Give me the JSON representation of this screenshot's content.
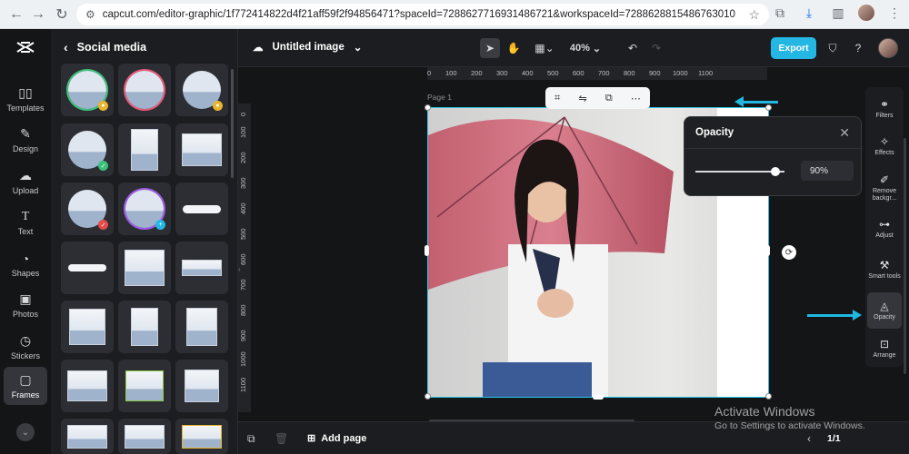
{
  "browser": {
    "url": "capcut.com/editor-graphic/1f772414822d4f21aff59f2f94856471?spaceId=7288627716931486721&workspaceId=7288628815486763010"
  },
  "rail": {
    "items": [
      {
        "label": "Templates",
        "icon": "templates-icon"
      },
      {
        "label": "Design",
        "icon": "design-icon"
      },
      {
        "label": "Upload",
        "icon": "upload-icon"
      },
      {
        "label": "Text",
        "icon": "text-icon"
      },
      {
        "label": "Shapes",
        "icon": "shapes-icon"
      },
      {
        "label": "Photos",
        "icon": "photos-icon"
      },
      {
        "label": "Stickers",
        "icon": "stickers-icon"
      },
      {
        "label": "Frames",
        "icon": "frames-icon"
      }
    ],
    "active": "Frames"
  },
  "panel": {
    "title": "Social media"
  },
  "topbar": {
    "doc_title": "Untitled image",
    "zoom": "40%",
    "export_label": "Export"
  },
  "canvas": {
    "page_label": "Page 1",
    "ruler_h": [
      "0",
      "100",
      "200",
      "300",
      "400",
      "500",
      "600",
      "700",
      "800",
      "900",
      "1000",
      "1100"
    ],
    "ruler_v": [
      "0",
      "100",
      "200",
      "300",
      "400",
      "500",
      "600",
      "700",
      "800",
      "900",
      "1000",
      "1100"
    ]
  },
  "opacity": {
    "title": "Opacity",
    "value": "90%",
    "level": 0.9
  },
  "props": [
    {
      "label": "Filters",
      "icon": "filters-icon"
    },
    {
      "label": "Effects",
      "icon": "effects-icon"
    },
    {
      "label": "Remove backgr...",
      "icon": "remove-background-icon"
    },
    {
      "label": "Adjust",
      "icon": "adjust-icon"
    },
    {
      "label": "Smart tools",
      "icon": "smart-tools-icon"
    },
    {
      "label": "Opacity",
      "icon": "opacity-icon"
    },
    {
      "label": "Arrange",
      "icon": "arrange-icon"
    }
  ],
  "bottom": {
    "add_page": "Add page",
    "page_count": "1/1"
  },
  "watermark": {
    "line1": "Activate Windows",
    "line2": "Go to Settings to activate Windows."
  },
  "colors": {
    "accent": "#25b7e4",
    "selection": "#2bc4e8",
    "arrow": "#1fb8e0"
  }
}
